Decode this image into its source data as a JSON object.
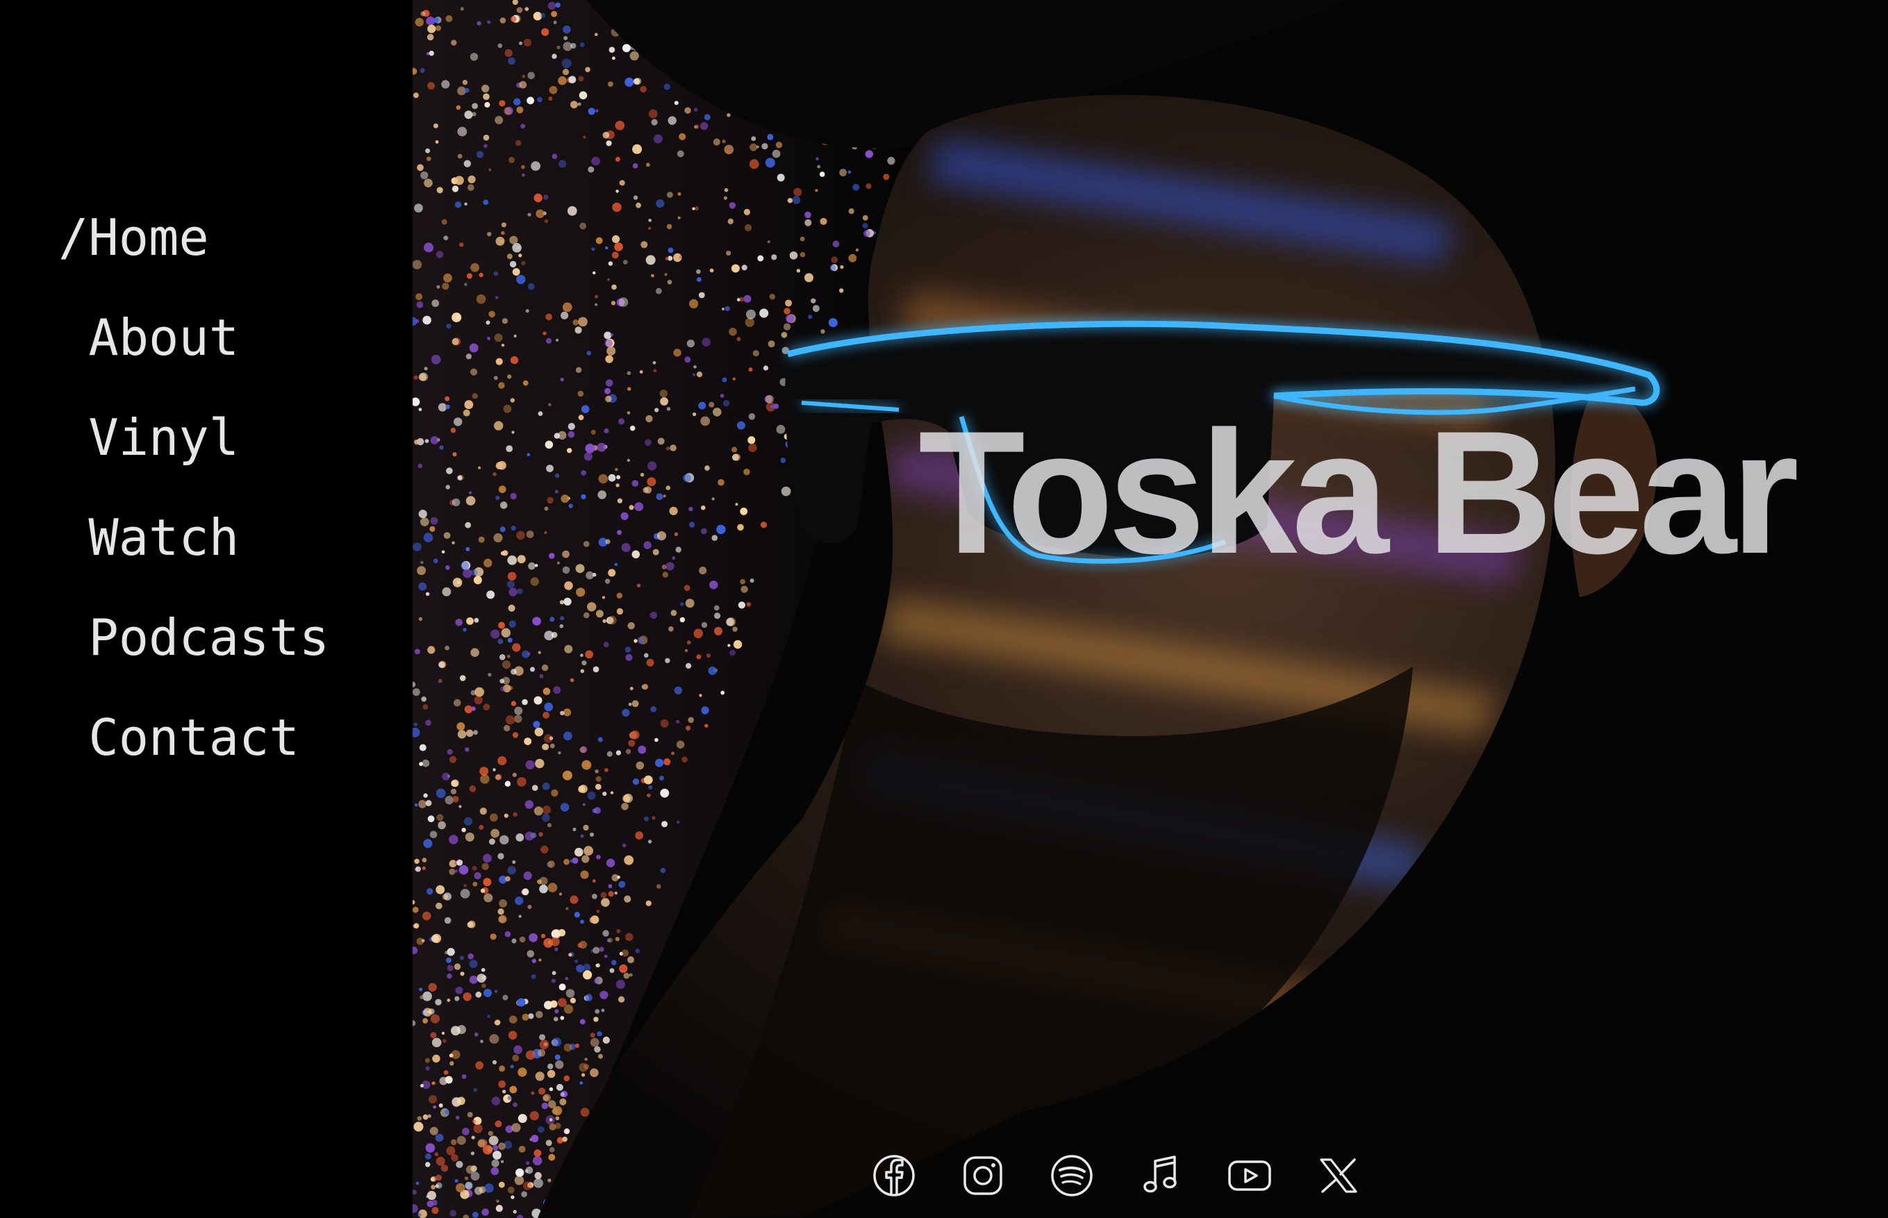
{
  "site": {
    "title": "Toska Bear"
  },
  "nav": {
    "active_prefix": "/",
    "items": [
      {
        "label": "Home",
        "active": true
      },
      {
        "label": "About",
        "active": false
      },
      {
        "label": "Vinyl",
        "active": false
      },
      {
        "label": "Watch",
        "active": false
      },
      {
        "label": "Podcasts",
        "active": false
      },
      {
        "label": "Contact",
        "active": false
      }
    ]
  },
  "social": [
    {
      "icon": "facebook-icon"
    },
    {
      "icon": "instagram-icon"
    },
    {
      "icon": "spotify-icon"
    },
    {
      "icon": "apple-music-icon"
    },
    {
      "icon": "youtube-icon"
    },
    {
      "icon": "x-icon"
    }
  ],
  "colors": {
    "background": "#000000",
    "nav_text": "#e6e6e6",
    "title_text": "#e1e1e4",
    "glasses_glow": "#3fb6ff",
    "icon_stroke": "#e8e8e8"
  }
}
